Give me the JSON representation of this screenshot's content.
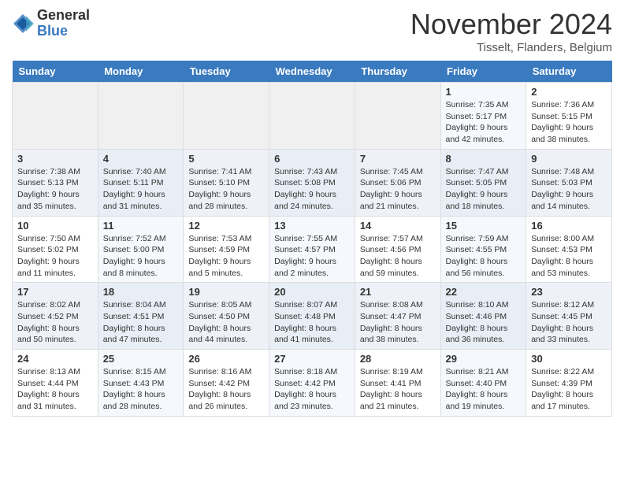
{
  "header": {
    "logo_general": "General",
    "logo_blue": "Blue",
    "month": "November 2024",
    "location": "Tisselt, Flanders, Belgium"
  },
  "days_of_week": [
    "Sunday",
    "Monday",
    "Tuesday",
    "Wednesday",
    "Thursday",
    "Friday",
    "Saturday"
  ],
  "weeks": [
    {
      "days": [
        {
          "num": "",
          "info": ""
        },
        {
          "num": "",
          "info": ""
        },
        {
          "num": "",
          "info": ""
        },
        {
          "num": "",
          "info": ""
        },
        {
          "num": "",
          "info": ""
        },
        {
          "num": "1",
          "info": "Sunrise: 7:35 AM\nSunset: 5:17 PM\nDaylight: 9 hours\nand 42 minutes."
        },
        {
          "num": "2",
          "info": "Sunrise: 7:36 AM\nSunset: 5:15 PM\nDaylight: 9 hours\nand 38 minutes."
        }
      ]
    },
    {
      "days": [
        {
          "num": "3",
          "info": "Sunrise: 7:38 AM\nSunset: 5:13 PM\nDaylight: 9 hours\nand 35 minutes."
        },
        {
          "num": "4",
          "info": "Sunrise: 7:40 AM\nSunset: 5:11 PM\nDaylight: 9 hours\nand 31 minutes."
        },
        {
          "num": "5",
          "info": "Sunrise: 7:41 AM\nSunset: 5:10 PM\nDaylight: 9 hours\nand 28 minutes."
        },
        {
          "num": "6",
          "info": "Sunrise: 7:43 AM\nSunset: 5:08 PM\nDaylight: 9 hours\nand 24 minutes."
        },
        {
          "num": "7",
          "info": "Sunrise: 7:45 AM\nSunset: 5:06 PM\nDaylight: 9 hours\nand 21 minutes."
        },
        {
          "num": "8",
          "info": "Sunrise: 7:47 AM\nSunset: 5:05 PM\nDaylight: 9 hours\nand 18 minutes."
        },
        {
          "num": "9",
          "info": "Sunrise: 7:48 AM\nSunset: 5:03 PM\nDaylight: 9 hours\nand 14 minutes."
        }
      ]
    },
    {
      "days": [
        {
          "num": "10",
          "info": "Sunrise: 7:50 AM\nSunset: 5:02 PM\nDaylight: 9 hours\nand 11 minutes."
        },
        {
          "num": "11",
          "info": "Sunrise: 7:52 AM\nSunset: 5:00 PM\nDaylight: 9 hours\nand 8 minutes."
        },
        {
          "num": "12",
          "info": "Sunrise: 7:53 AM\nSunset: 4:59 PM\nDaylight: 9 hours\nand 5 minutes."
        },
        {
          "num": "13",
          "info": "Sunrise: 7:55 AM\nSunset: 4:57 PM\nDaylight: 9 hours\nand 2 minutes."
        },
        {
          "num": "14",
          "info": "Sunrise: 7:57 AM\nSunset: 4:56 PM\nDaylight: 8 hours\nand 59 minutes."
        },
        {
          "num": "15",
          "info": "Sunrise: 7:59 AM\nSunset: 4:55 PM\nDaylight: 8 hours\nand 56 minutes."
        },
        {
          "num": "16",
          "info": "Sunrise: 8:00 AM\nSunset: 4:53 PM\nDaylight: 8 hours\nand 53 minutes."
        }
      ]
    },
    {
      "days": [
        {
          "num": "17",
          "info": "Sunrise: 8:02 AM\nSunset: 4:52 PM\nDaylight: 8 hours\nand 50 minutes."
        },
        {
          "num": "18",
          "info": "Sunrise: 8:04 AM\nSunset: 4:51 PM\nDaylight: 8 hours\nand 47 minutes."
        },
        {
          "num": "19",
          "info": "Sunrise: 8:05 AM\nSunset: 4:50 PM\nDaylight: 8 hours\nand 44 minutes."
        },
        {
          "num": "20",
          "info": "Sunrise: 8:07 AM\nSunset: 4:48 PM\nDaylight: 8 hours\nand 41 minutes."
        },
        {
          "num": "21",
          "info": "Sunrise: 8:08 AM\nSunset: 4:47 PM\nDaylight: 8 hours\nand 38 minutes."
        },
        {
          "num": "22",
          "info": "Sunrise: 8:10 AM\nSunset: 4:46 PM\nDaylight: 8 hours\nand 36 minutes."
        },
        {
          "num": "23",
          "info": "Sunrise: 8:12 AM\nSunset: 4:45 PM\nDaylight: 8 hours\nand 33 minutes."
        }
      ]
    },
    {
      "days": [
        {
          "num": "24",
          "info": "Sunrise: 8:13 AM\nSunset: 4:44 PM\nDaylight: 8 hours\nand 31 minutes."
        },
        {
          "num": "25",
          "info": "Sunrise: 8:15 AM\nSunset: 4:43 PM\nDaylight: 8 hours\nand 28 minutes."
        },
        {
          "num": "26",
          "info": "Sunrise: 8:16 AM\nSunset: 4:42 PM\nDaylight: 8 hours\nand 26 minutes."
        },
        {
          "num": "27",
          "info": "Sunrise: 8:18 AM\nSunset: 4:42 PM\nDaylight: 8 hours\nand 23 minutes."
        },
        {
          "num": "28",
          "info": "Sunrise: 8:19 AM\nSunset: 4:41 PM\nDaylight: 8 hours\nand 21 minutes."
        },
        {
          "num": "29",
          "info": "Sunrise: 8:21 AM\nSunset: 4:40 PM\nDaylight: 8 hours\nand 19 minutes."
        },
        {
          "num": "30",
          "info": "Sunrise: 8:22 AM\nSunset: 4:39 PM\nDaylight: 8 hours\nand 17 minutes."
        }
      ]
    }
  ]
}
